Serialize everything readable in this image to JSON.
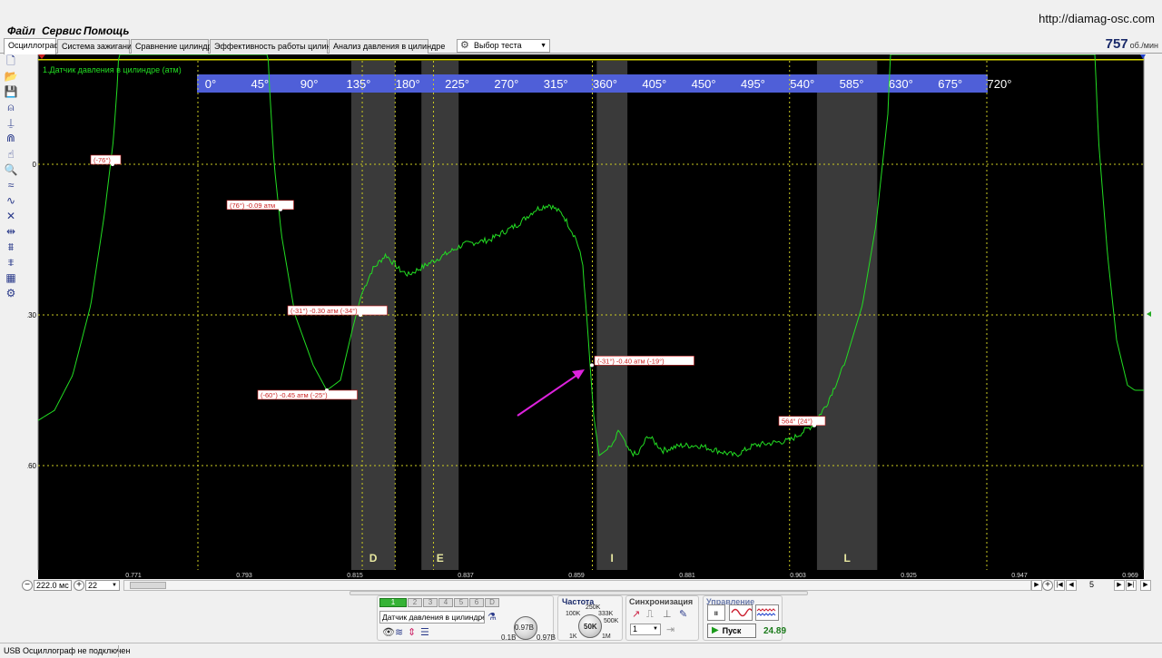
{
  "menu": {
    "items": [
      "Файл",
      "Сервис",
      "Помощь"
    ],
    "site_url": "http://diamag-osc.com"
  },
  "tabs": [
    {
      "label": "Осциллограф",
      "active": true
    },
    {
      "label": "Система зажигания"
    },
    {
      "label": "Сравнение цилиндров"
    },
    {
      "label": "Эффективность работы цилиндров"
    },
    {
      "label": "Анализ давления в цилиндре"
    }
  ],
  "test_select": {
    "label": "Выбор теста"
  },
  "rpm": {
    "value": "757",
    "unit": "об./мин"
  },
  "left_toolbar": [
    "new-file-icon",
    "open-folder-icon",
    "save-icon",
    "ghost-icon",
    "measure-icon",
    "magnet-icon",
    "hand-icon",
    "zoom-icon",
    "waveform-icon",
    "math-icon",
    "filter-icon",
    "cursor-icon",
    "funnel-icon",
    "fft-icon",
    "table-icon",
    "settings-icon"
  ],
  "oscilloscope": {
    "channel_label": "1.Датчик давления в цилиндре (атм)",
    "trace_color": "#22dd22",
    "angle_labels": [
      "0°",
      "45°",
      "90°",
      "135°",
      "180°",
      "225°",
      "270°",
      "315°",
      "360°",
      "405°",
      "450°",
      "495°",
      "540°",
      "585°",
      "630°",
      "675°",
      "720°"
    ],
    "y_ticks": [
      "0",
      "-0.30",
      "-0.60"
    ],
    "x_ticks": [
      "0.771",
      "0.793",
      "0.815",
      "0.837",
      "0.859",
      "0.881",
      "0.903",
      "0.925",
      "0.947",
      "0.969"
    ],
    "phase_letters": [
      "D",
      "E",
      "I",
      "L"
    ],
    "markers": [
      "(-76°)",
      "(76°) -0.09 атм",
      "(-31°) -0.30 атм (-34°)",
      "(-60°) -0.45 атм (-25°)",
      "(-31°) -0.40 атм (-19°)",
      "564° (24°)"
    ]
  },
  "zoom": {
    "time_per_div": "222.0 мс",
    "zoom_level": "22",
    "page": "5"
  },
  "channels_panel": {
    "buttons": [
      "1",
      "2",
      "3",
      "4",
      "5",
      "6",
      "D"
    ],
    "sensor": "Датчик давления в цилиндре",
    "gain_value": "0.97В",
    "gain_min": "0.1В",
    "gain_max": "0.97В"
  },
  "frequency": {
    "title": "Частота",
    "value": "50K",
    "scale": [
      "100K",
      "250K",
      "333K",
      "500K",
      "1K",
      "1M"
    ]
  },
  "sync": {
    "title": "Синхронизация",
    "channel": "1"
  },
  "control": {
    "title": "Управление",
    "start_label": "Пуск",
    "timer": "24.89"
  },
  "status": {
    "text": "USB Осциллограф не подключен"
  }
}
